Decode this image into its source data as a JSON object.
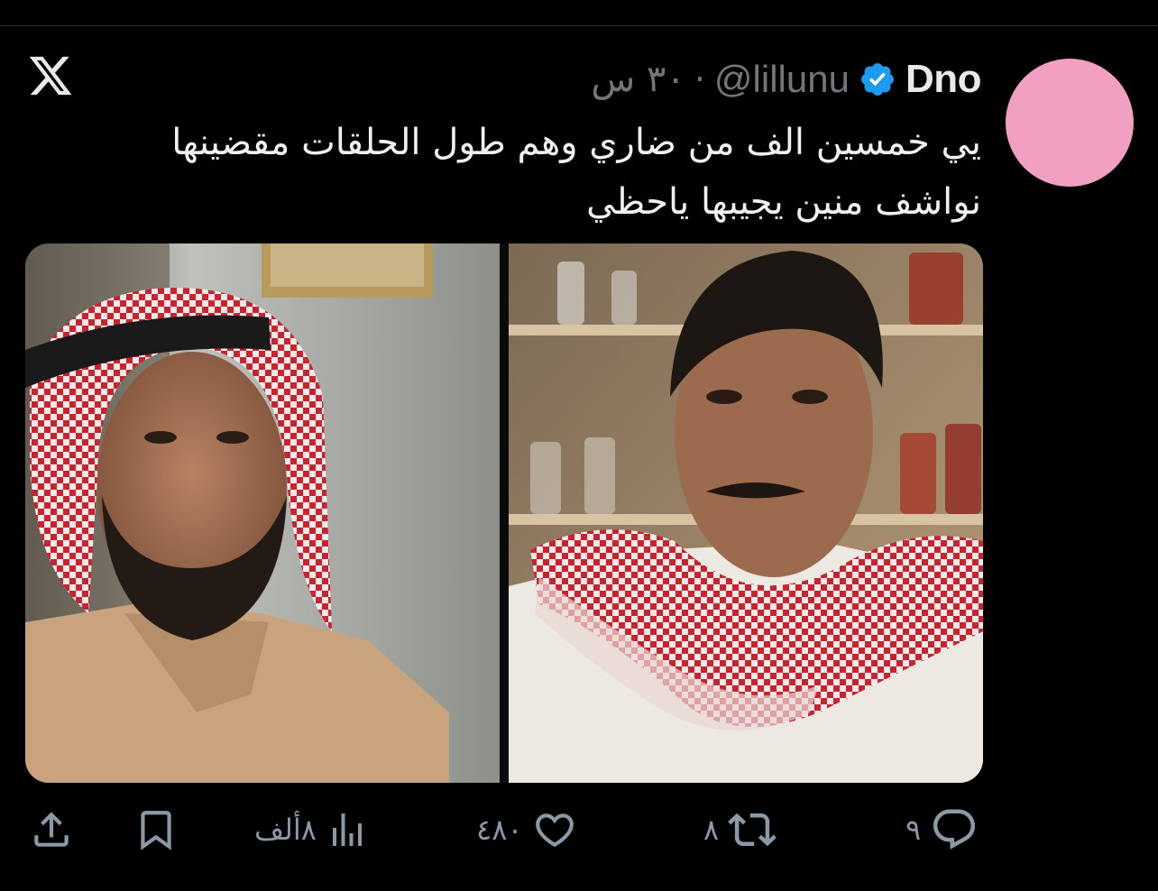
{
  "header": {
    "display_name": "Dno",
    "handle": "@lillunu",
    "separator": "·",
    "time": "٣٠ س"
  },
  "tweet": {
    "line1": "يي خمسين الف من ضاري وهم طول الحلقات مقضينها",
    "line2": "نواشف منين يجيبها ياحظي"
  },
  "actions": {
    "replies": "٩",
    "retweets": "٨",
    "likes": "٤٨٠",
    "views": "٨ألف"
  },
  "colors": {
    "background": "#000000",
    "avatar": "#f2a0c2",
    "verified": "#1d9bf0",
    "muted": "#71767b",
    "text": "#e7e9ea"
  },
  "icons": {
    "logo": "x-logo-icon",
    "verified": "verified-badge-icon",
    "reply": "reply-icon",
    "retweet": "retweet-icon",
    "like": "heart-icon",
    "views": "views-icon",
    "bookmark": "bookmark-icon",
    "share": "share-icon"
  }
}
